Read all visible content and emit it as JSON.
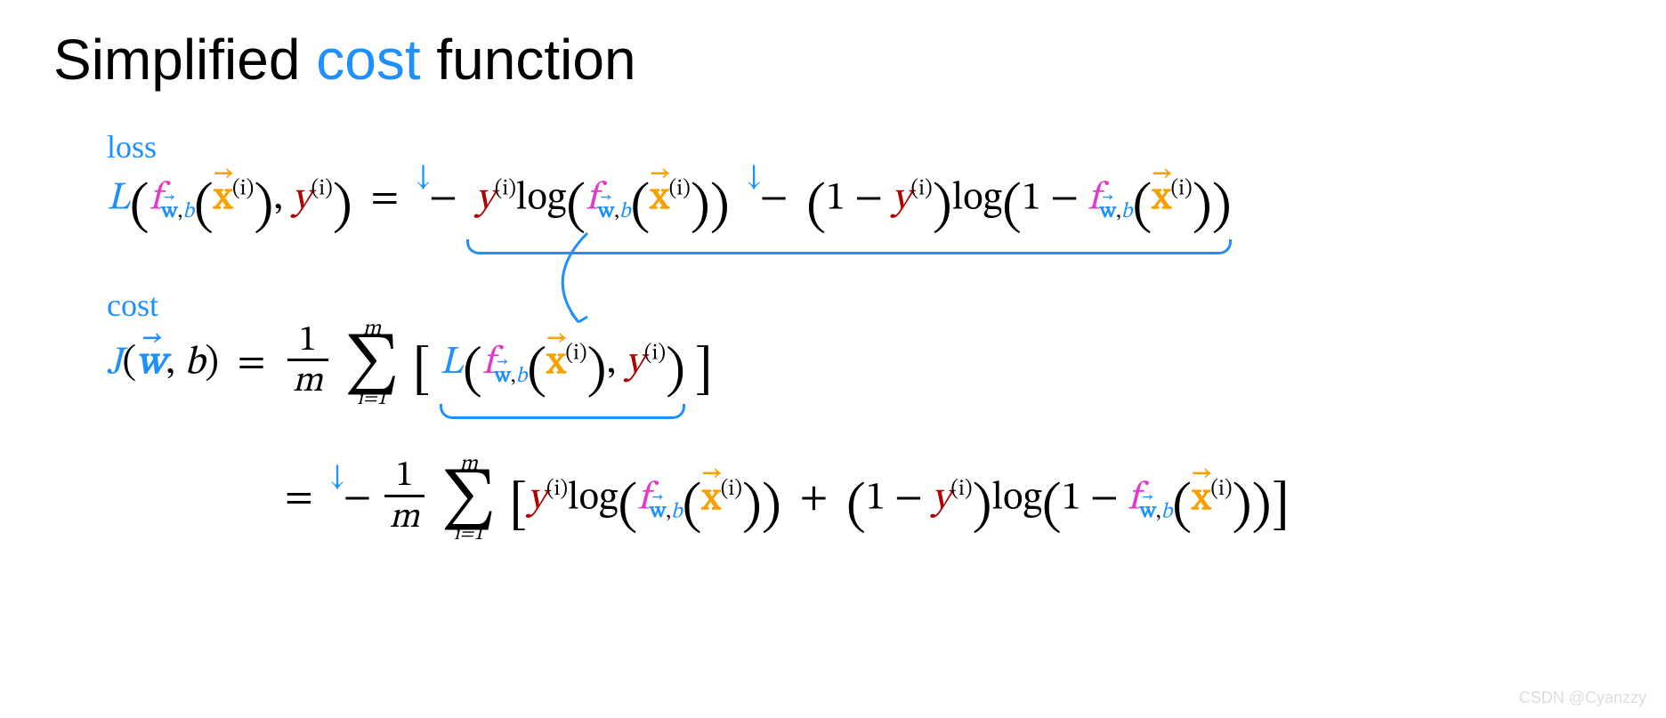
{
  "title": {
    "pre": "Simplified ",
    "cost": "cost",
    "post": " function"
  },
  "annot": {
    "loss": "loss",
    "cost": "cost"
  },
  "sym": {
    "L": "L",
    "J": "J",
    "f": "f",
    "w": "w",
    "b": "b",
    "x": "x",
    "y": "y",
    "i": "i",
    "m": "m",
    "one": "1",
    "eq": "=",
    "minus": "−",
    "plus": "+",
    "comma": ",",
    "log": "log",
    "down": "↓"
  },
  "sup": {
    "i": "(i)"
  },
  "sum": {
    "top": "m",
    "bot": "i=1"
  },
  "frac": {
    "num": "1",
    "den": "m"
  },
  "watermark": "CSDN @Cyanzzy",
  "formulas": {
    "loss_plain": "L(f_{w,b}(x^(i)), y^(i)) = - y^(i) log( f_{w,b}(x^(i)) ) - (1 - y^(i)) log( 1 - f_{w,b}(x^(i)) )",
    "cost_plain": "J(w, b) = (1/m) Σ_{i=1}^{m} [ L( f_{w,b}(x^(i)), y^(i) ) ]",
    "cost_expanded_plain": "= - (1/m) Σ_{i=1}^{m} [ y^(i) log( f_{w,b}(x^(i)) ) + (1 - y^(i)) log( 1 - f_{w,b}(x^(i)) ) ]"
  }
}
